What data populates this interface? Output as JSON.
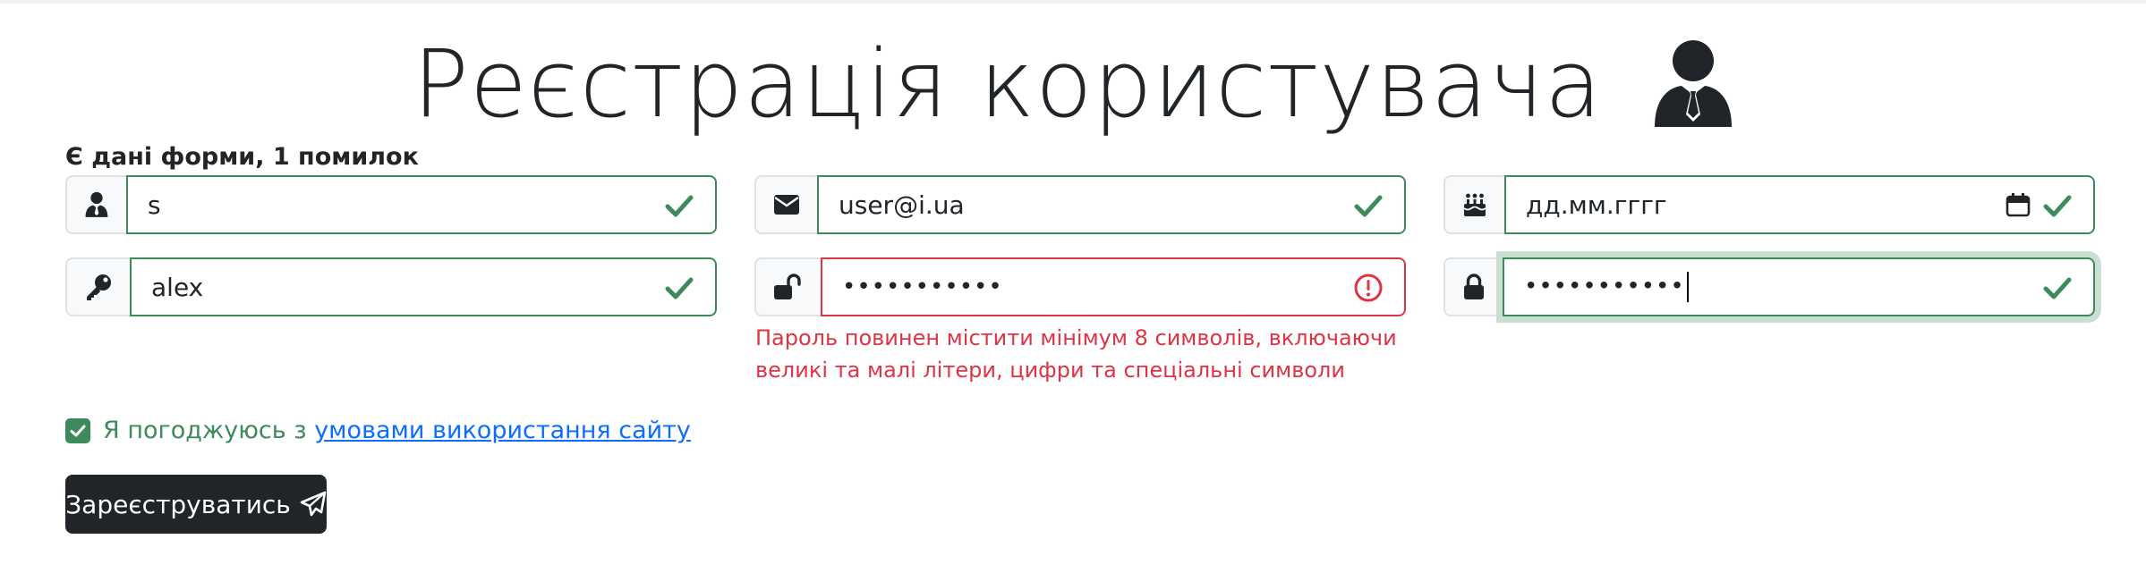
{
  "page": {
    "title": "Реєстрація користувача",
    "title_icon": "user-tie-icon"
  },
  "form": {
    "status": "Є дані форми, 1 помилок",
    "fields": {
      "login": {
        "icon": "user-tie-icon",
        "value": "s",
        "state": "valid"
      },
      "email": {
        "icon": "envelope-icon",
        "value": "user@i.ua",
        "state": "valid"
      },
      "birthdate": {
        "icon": "birthday-cake-icon",
        "value": "дд.мм.гггг",
        "state": "valid"
      },
      "name": {
        "icon": "key-icon",
        "value": "alex",
        "state": "valid"
      },
      "password": {
        "icon": "lock-open-icon",
        "value": "•••••••••••",
        "state": "invalid",
        "error": "Пароль повинен містити мінімум 8 символів, включаючи великі та малі літери, цифри та спеціальні символи"
      },
      "password_repeat": {
        "icon": "lock-icon",
        "value": "•••••••••••",
        "state": "valid"
      }
    },
    "agree": {
      "checked": true,
      "text": "Я погоджуюсь з ",
      "link_text": "умовами використання сайту"
    },
    "submit_label": "Зареєструватись"
  },
  "colors": {
    "valid": "#3d8a5c",
    "invalid": "#dc3545",
    "link": "#0d6efd",
    "button_bg": "#212529"
  }
}
